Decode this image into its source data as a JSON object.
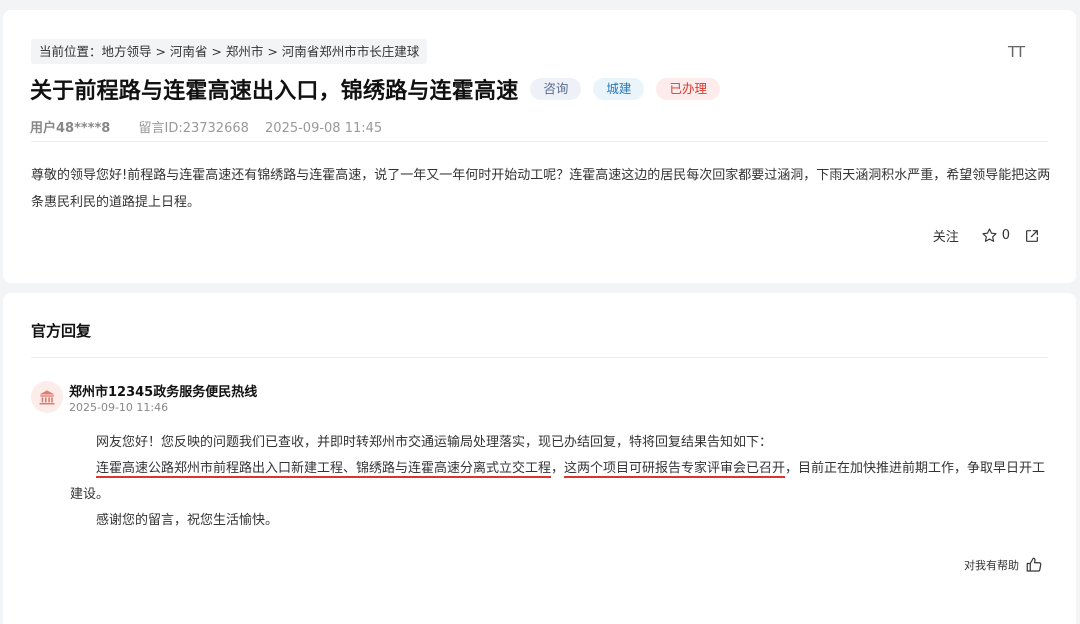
{
  "post": {
    "breadcrumb": "当前位置：地方领导 > 河南省 > 郑州市 > 河南省郑州市市长庄建球",
    "font_toggle": "TT",
    "title": "关于前程路与连霍高速出入口，锦绣路与连霍高速",
    "tags": [
      "咨询",
      "城建",
      "已办理"
    ],
    "user": "用户48****8",
    "message_id": "留言ID:23732668",
    "time": "2025-09-08 11:45",
    "content": "尊敬的领导您好!前程路与连霍高速还有锦绣路与连霍高速，说了一年又一年何时开始动工呢？连霍高速这边的居民每次回家都要过涵洞，下雨天涵洞积水严重，希望领导能把这两条惠民利民的道路提上日程。",
    "follow_label": "关注",
    "star_count": "0"
  },
  "reply": {
    "section_title": "官方回复",
    "org_name": "郑州市12345政务服务便民热线",
    "time": "2025-09-10 11:46",
    "line1": "网友您好！您反映的问题我们已查收，并即时转郑州市交通运输局处理落实，现已办结回复，特将回复结果告知如下：",
    "line2_part1": "连霍高速公路郑州市前程路出入口新建工程、锦绣路与连霍高速分离式立交工程",
    "line2_sep": "，",
    "line2_part2": "这两个项目可研报告专家评审会已召开",
    "line2_rest": "，目前正在加快推进前期工作，争取早日开工建设。",
    "line3": "感谢您的留言，祝您生活愉快。",
    "helpful_label": "对我有帮助"
  },
  "colors": {
    "accent_red": "#d9362d",
    "tag_city": "#2a78b8",
    "tag_consult": "#5a6c8c"
  }
}
